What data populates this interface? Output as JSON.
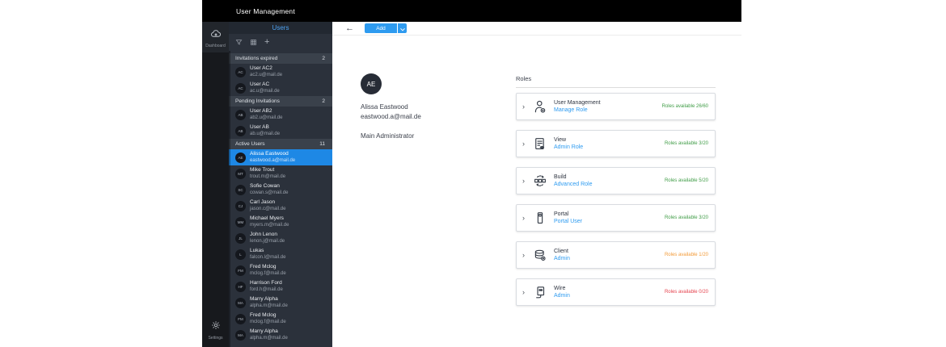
{
  "app": {
    "title": "User Management"
  },
  "colors": {
    "accent_blue": "#2e9bf0",
    "selected_blue": "#1e88e5",
    "status_green": "#3f9c46",
    "status_orange": "#f29a37",
    "status_red": "#e5424d"
  },
  "rail": {
    "dashboard_label": "Dashboard",
    "settings_label": "Settings"
  },
  "sidebar": {
    "title": "Users",
    "sections": [
      {
        "label": "Invitations expired",
        "count": "2",
        "users": [
          {
            "initials": "AC",
            "name": "User AC2",
            "email": "ac2.u@mail.de"
          },
          {
            "initials": "AC",
            "name": "User AC",
            "email": "ac.u@mail.de"
          }
        ]
      },
      {
        "label": "Pending Invitations",
        "count": "2",
        "users": [
          {
            "initials": "AB",
            "name": "User AB2",
            "email": "ab2.u@mail.de"
          },
          {
            "initials": "AB",
            "name": "User AB",
            "email": "ab.u@mail.de"
          }
        ]
      },
      {
        "label": "Active Users",
        "count": "11",
        "selected_index": 0,
        "users": [
          {
            "initials": "AE",
            "name": "Alissa Eastwood",
            "email": "eastwood.a@mail.de"
          },
          {
            "initials": "MT",
            "name": "Mike Trout",
            "email": "trout.m@mail.de"
          },
          {
            "initials": "SC",
            "name": "Sofie Cowan",
            "email": "cowan.s@mail.de"
          },
          {
            "initials": "CJ",
            "name": "Carl Jason",
            "email": "jason.c@mail.de"
          },
          {
            "initials": "MM",
            "name": "Michael Myers",
            "email": "myers.m@mail.de"
          },
          {
            "initials": "JL",
            "name": "John Lenon",
            "email": "lenon.j@mail.de"
          },
          {
            "initials": "L",
            "name": "Lukas",
            "email": "falcon.l@mail.de"
          },
          {
            "initials": "FM",
            "name": "Fred Mclog",
            "email": "mclog.f@mail.de"
          },
          {
            "initials": "HF",
            "name": "Harrison Ford",
            "email": "ford.h@mail.de"
          },
          {
            "initials": "MA",
            "name": "Marry Alpha",
            "email": "alpha.m@mail.de"
          },
          {
            "initials": "FM",
            "name": "Fred Mclog",
            "email": "mclog.f@mail.de"
          },
          {
            "initials": "MA",
            "name": "Marry Alpha",
            "email": "alpha.m@mail.de"
          }
        ]
      }
    ]
  },
  "toolbar": {
    "add_label": "Add"
  },
  "profile": {
    "initials": "AE",
    "name": "Alissa Eastwood",
    "email": "eastwood.a@mail.de",
    "role": "Main Administrator"
  },
  "roles": {
    "header": "Roles",
    "cards": [
      {
        "icon": "user-management-icon",
        "title": "User Management",
        "link": "Manage Role",
        "status": "Roles available 26/60",
        "status_color": "#3f9c46"
      },
      {
        "icon": "view-icon",
        "title": "View",
        "link": "Admin Role",
        "status": "Roles available 3/20",
        "status_color": "#3f9c46"
      },
      {
        "icon": "build-icon",
        "title": "Build",
        "link": "Advanced Role",
        "status": "Roles available 5/20",
        "status_color": "#3f9c46"
      },
      {
        "icon": "portal-icon",
        "title": "Portal",
        "link": "Portal User",
        "status": "Roles available 3/20",
        "status_color": "#3f9c46"
      },
      {
        "icon": "client-icon",
        "title": "Client",
        "link": "Admin",
        "status": "Roles available 1/20",
        "status_color": "#f29a37"
      },
      {
        "icon": "wire-icon",
        "title": "Wire",
        "link": "Admin",
        "status": "Roles available 0/20",
        "status_color": "#e5424d"
      }
    ]
  }
}
